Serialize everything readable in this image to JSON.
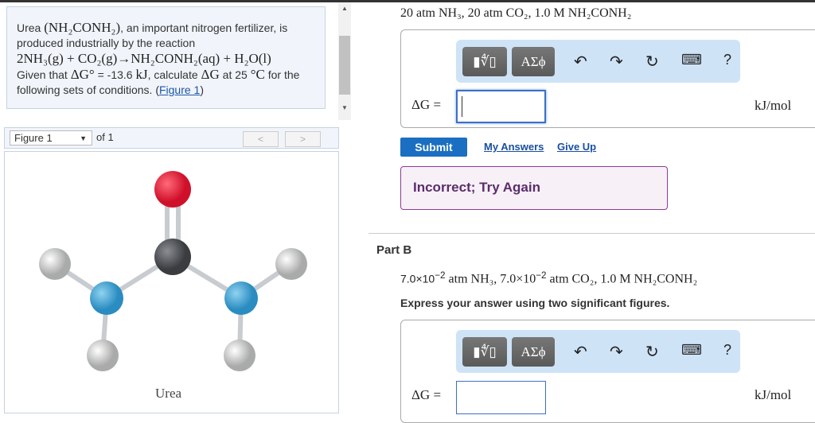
{
  "problem": {
    "t1": "Urea ",
    "t2": "(NH₂CONH₂)",
    "t3": ", an important nitrogen fertilizer, is produced industrially by the reaction",
    "reaction": "2NH₃(g) + CO₂(g)→NH₂CONH₂(aq) + H₂O(l)",
    "t4": "Given that ",
    "dg0": "ΔG°",
    "t5": " = -13.6 ",
    "kj": "kJ",
    "t6": ", calculate ",
    "dg": "ΔG",
    "t7": " at 25 ",
    "degc": "°C",
    "t8": " for the following sets of conditions. (",
    "fig_link": "Figure 1",
    "t9": ")"
  },
  "figure": {
    "select": "Figure 1",
    "of": "of 1",
    "prev": "<",
    "next": ">",
    "caption": "Urea"
  },
  "part_a": {
    "question": "20 atm NH₃, 20 atm CO₂, 1.0 M NH₂CONH₂",
    "label": "ΔG =",
    "unit": "kJ/mol",
    "submit": "Submit",
    "my_answers": "My Answers",
    "give_up": "Give Up",
    "feedback": "Incorrect; Try Again"
  },
  "toolbar": {
    "templates": "▮∜▯",
    "symbols": "ΑΣϕ",
    "undo": "↶",
    "redo": "↷",
    "reset": "↻",
    "keyboard": "⌨",
    "help": "?"
  },
  "part_b": {
    "title": "Part B",
    "q1": "7.0×10",
    "e1": "−2",
    "q2": " atm NH₃, 7.0×10",
    "e2": "−2",
    "q3": " atm CO₂, 1.0 M NH₂CONH₂",
    "instruction": "Express your answer using two significant figures.",
    "label": "ΔG =",
    "unit": "kJ/mol"
  }
}
